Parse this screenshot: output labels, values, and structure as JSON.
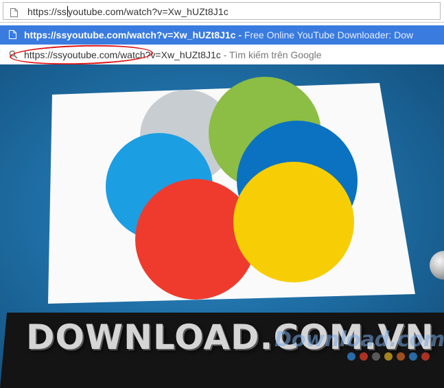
{
  "address_bar": {
    "text_before_caret": "https://ss",
    "text_after_caret": "youtube.com/watch?v=Xw_hUZt8J1c"
  },
  "suggestions": [
    {
      "url": "https://ssyoutube.com/watch?v=Xw_hUZt8J1c",
      "separator": " - ",
      "description": "Free Online YouTube Downloader: Dow",
      "icon": "page-icon",
      "selected": true
    },
    {
      "url": "https://ssyoutube.com/watch?v=Xw_hUZt8J1c",
      "separator": " - ",
      "description": "Tìm kiếm trên Google",
      "icon": "search-icon",
      "selected": false
    }
  ],
  "video": {
    "brand_text": "DOWNLOAD.COM.VN",
    "watermark": "Download.com.vn",
    "petal_colors": [
      "#c8cdd2",
      "#8cbd45",
      "#0a72c0",
      "#f7ce05",
      "#ee3b2e",
      "#1c9ee2"
    ],
    "dot_colors": [
      "#2f7fcc",
      "#d23a2a",
      "#6a6a6a",
      "#c8a020",
      "#c06020",
      "#2f7fcc",
      "#d23a2a"
    ]
  },
  "colors": {
    "selection": "#3a7be0",
    "annotation": "#dd1111"
  }
}
